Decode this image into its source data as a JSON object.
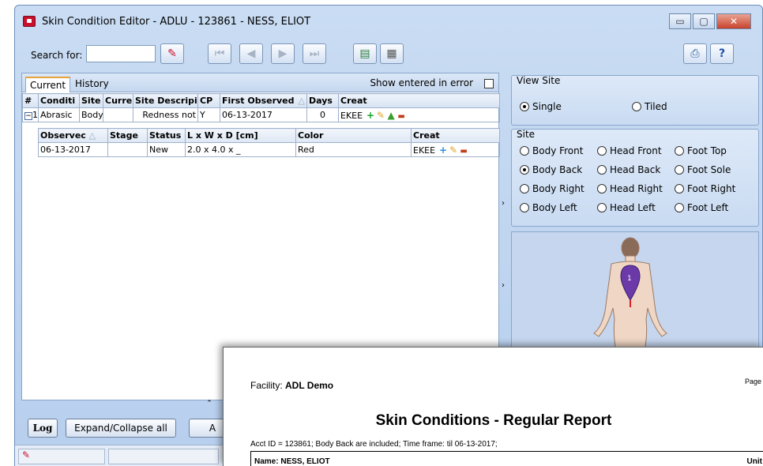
{
  "window": {
    "title": "Skin Condition Editor - ADLU - 123861 - NESS, ELIOT",
    "buttons": {
      "minimize": "▭",
      "maximize": "▢",
      "close": "✕"
    }
  },
  "toolbar": {
    "search_label": "Search for:",
    "search_value": "",
    "icons": [
      "eraser-icon",
      "first-icon",
      "prev-icon",
      "next-icon",
      "last-icon",
      "report-icon",
      "document-icon",
      "print-icon",
      "help-icon"
    ]
  },
  "tabs": {
    "current": "Current",
    "history": "History"
  },
  "show_entered_in_error": "Show entered in error",
  "conditions_table": {
    "headers": [
      "#",
      "Conditi",
      "Site",
      "Curre",
      "Site Descripi",
      "CP",
      "First Observed",
      "Days",
      "Creat"
    ],
    "rows": [
      {
        "num": "1",
        "condition": "Abrasic",
        "site": "Body",
        "current": "",
        "site_desc": "Redness not",
        "cp": "Y",
        "first_observed": "06-13-2017",
        "days": "0",
        "created": "EKEE"
      }
    ]
  },
  "observations_table": {
    "headers": [
      "Observec",
      "Stage",
      "Status",
      "L x W x D [cm]",
      "Color",
      "Creat"
    ],
    "rows": [
      {
        "observed": "06-13-2017",
        "stage": "",
        "status": "New",
        "size": "2.0 x 4.0 x _",
        "color": "Red",
        "created": "EKEE"
      }
    ]
  },
  "view_site": {
    "label": "View Site",
    "single": "Single",
    "tiled": "Tiled",
    "selected": "single"
  },
  "site": {
    "label": "Site",
    "options": [
      [
        "Body Front",
        "Head Front",
        "Foot Top"
      ],
      [
        "Body Back",
        "Head Back",
        "Foot Sole"
      ],
      [
        "Body Right",
        "Head Right",
        "Foot Right"
      ],
      [
        "Body Left",
        "Head Left",
        "Foot Left"
      ]
    ],
    "selected": "Body Back",
    "marker_label": "1"
  },
  "bottom": {
    "log": "Log",
    "expand_collapse": "Expand/Collapse all",
    "truncated": "A"
  },
  "report": {
    "facility_label": "Facility:",
    "facility_value": "ADL Demo",
    "page_label": "Page",
    "title": "Skin Conditions - Regular Report",
    "acct_line": "Acct ID = 123861; Body Back are included; Time frame: til 06-13-2017;",
    "name": "Name: NESS, ELIOT",
    "unit": "Unit"
  },
  "colors": {
    "accent": "#c8102e",
    "frame": "#b7cfee",
    "tab_highlight": "#e8a33c"
  }
}
